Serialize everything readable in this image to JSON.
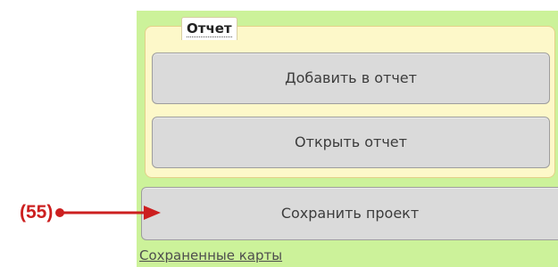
{
  "report": {
    "legend": "Отчет",
    "add_label": "Добавить в отчет",
    "open_label": "Открыть отчет"
  },
  "save_project_label": "Сохранить проект",
  "saved_maps_link": "Сохраненные карты",
  "callout": {
    "label": "(55)",
    "color": "#cc1f1f"
  },
  "colors": {
    "panel_background": "#ccf29a",
    "fieldset_background": "#fdf8c9",
    "button_background": "#dadada"
  }
}
